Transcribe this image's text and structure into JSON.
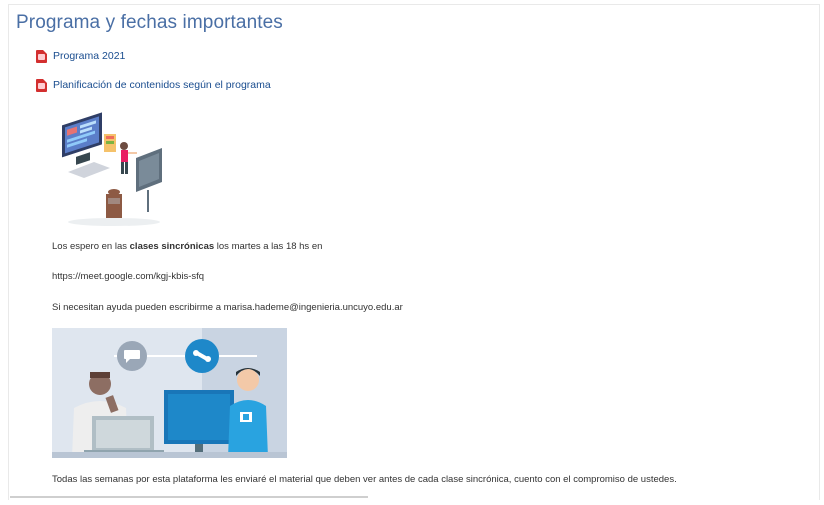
{
  "section": {
    "title": "Programa y fechas importantes"
  },
  "resources": [
    {
      "label": "Programa 2021",
      "icon": "pdf-icon"
    },
    {
      "label": "Planificación de contenidos según el programa",
      "icon": "pdf-icon"
    }
  ],
  "content": {
    "line1_before": "Los espero en las ",
    "line1_bold": "clases sincrónicas",
    "line1_after": " los  martes a las 18 hs en",
    "meet_link": "https://meet.google.com/kgj-kbis-sfq",
    "help_text": "Si necesitan ayuda pueden escribirme a marisa.hademe@ingenieria.uncuyo.edu.ar",
    "weekly_text": "Todas las semanas por esta plataforma les enviaré el material que deben ver antes de cada clase sincrónica, cuento con el compromiso de ustedes."
  },
  "colors": {
    "title": "#4a6fa5",
    "link": "#1a4d8f",
    "pdf_red": "#d32f2f",
    "accent_blue": "#1e88c9"
  }
}
